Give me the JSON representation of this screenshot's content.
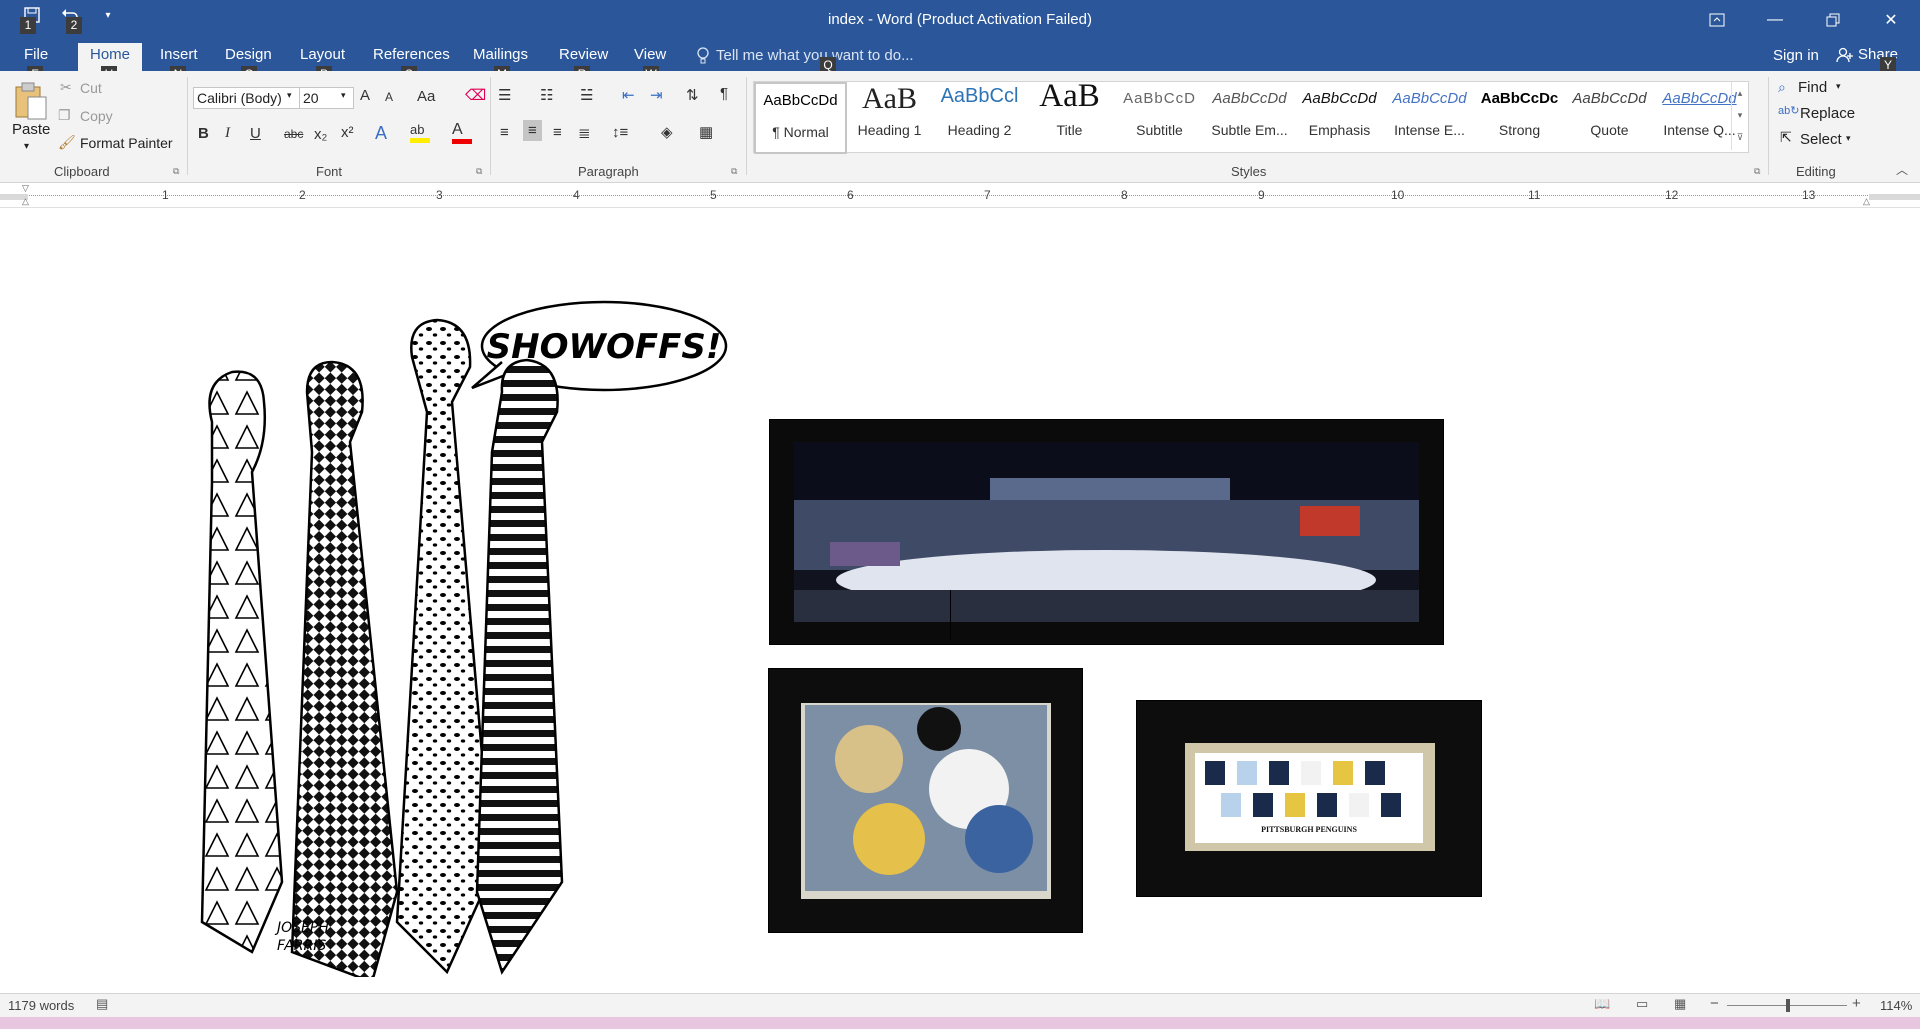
{
  "window": {
    "title": "index - Word (Product Activation Failed)"
  },
  "qat": {
    "keytip1": "1",
    "keytip2": "2"
  },
  "tabs": [
    {
      "label": "File",
      "keytip": "F"
    },
    {
      "label": "Home",
      "keytip": "H"
    },
    {
      "label": "Insert",
      "keytip": "N"
    },
    {
      "label": "Design",
      "keytip": "G"
    },
    {
      "label": "Layout",
      "keytip": "P"
    },
    {
      "label": "References",
      "keytip": "S"
    },
    {
      "label": "Mailings",
      "keytip": "M"
    },
    {
      "label": "Review",
      "keytip": "R"
    },
    {
      "label": "View",
      "keytip": "W"
    }
  ],
  "tell_me": {
    "placeholder": "Tell me what you want to do...",
    "keytip": "Q"
  },
  "account": {
    "sign_in": "Sign in",
    "share": "Share",
    "share_keytip": "Y"
  },
  "clipboard": {
    "paste": "Paste",
    "cut": "Cut",
    "copy": "Copy",
    "format_painter": "Format Painter",
    "label": "Clipboard"
  },
  "font": {
    "name": "Calibri (Body)",
    "size": "20",
    "label": "Font",
    "bold": "B",
    "italic": "I",
    "underline": "U",
    "strike": "abc",
    "sub": "x₂",
    "sup": "x²",
    "grow": "A",
    "shrink": "A",
    "case": "Aa"
  },
  "paragraph": {
    "label": "Paragraph"
  },
  "styles": {
    "label": "Styles",
    "items": [
      {
        "preview": "AaBbCcDd",
        "name": "¶ Normal"
      },
      {
        "preview": "AaB",
        "name": "Heading 1"
      },
      {
        "preview": "AaBbCcl",
        "name": "Heading 2"
      },
      {
        "preview": "AaB",
        "name": "Title"
      },
      {
        "preview": "AaBbCcD",
        "name": "Subtitle"
      },
      {
        "preview": "AaBbCcDd",
        "name": "Subtle Em..."
      },
      {
        "preview": "AaBbCcDd",
        "name": "Emphasis"
      },
      {
        "preview": "AaBbCcDd",
        "name": "Intense E..."
      },
      {
        "preview": "AaBbCcDc",
        "name": "Strong"
      },
      {
        "preview": "AaBbCcDd",
        "name": "Quote"
      },
      {
        "preview": "AaBbCcDd",
        "name": "Intense Q..."
      }
    ]
  },
  "editing": {
    "find": "Find",
    "replace": "Replace",
    "select": "Select",
    "label": "Editing"
  },
  "ruler": {
    "numbers": [
      "1",
      "2",
      "3",
      "4",
      "5",
      "6",
      "7",
      "8",
      "9",
      "10",
      "11",
      "12",
      "13"
    ]
  },
  "document": {
    "cartoon_speech": "SHOWOFFS!",
    "cartoon_signature_line1": "JOSEPH",
    "cartoon_signature_line2": "FARRIS",
    "penguins_caption": "PITTSBURGH PENGUINS"
  },
  "status": {
    "words": "1179 words",
    "zoom": "114%"
  }
}
